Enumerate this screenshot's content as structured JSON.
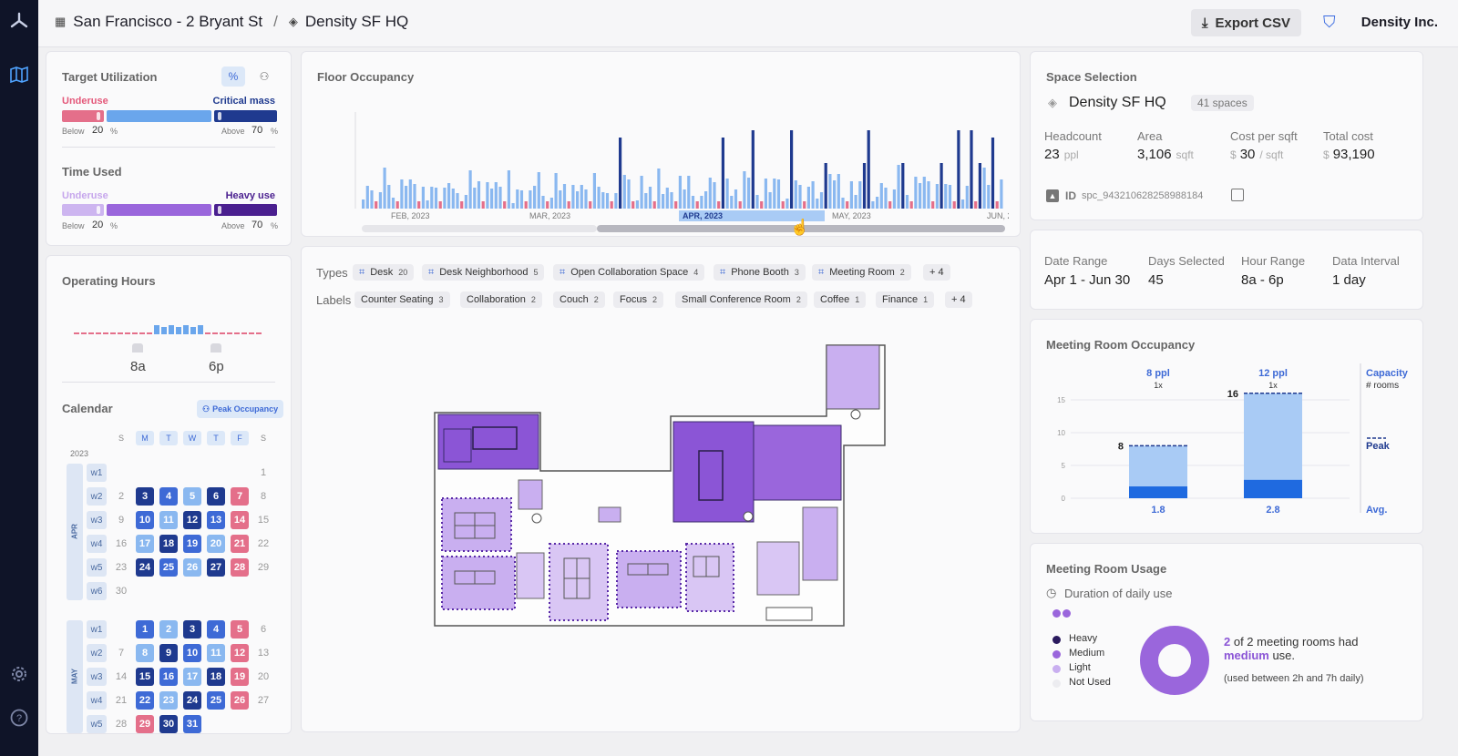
{
  "breadcrumb": {
    "site": "San Francisco - 2 Bryant St",
    "separator": "/",
    "space": "Density SF HQ"
  },
  "header": {
    "export_label": "Export CSV",
    "org_name": "Density Inc."
  },
  "target_utilization": {
    "title": "Target Utilization",
    "toggle_percent": "%",
    "underuse_label": "Underuse",
    "critical_label": "Critical mass",
    "below_label": "Below",
    "below_value": "20",
    "below_unit": "%",
    "above_label": "Above",
    "above_value": "70",
    "above_unit": "%"
  },
  "time_used": {
    "title": "Time Used",
    "underuse_label": "Underuse",
    "heavy_label": "Heavy use",
    "below_label": "Below",
    "below_value": "20",
    "below_unit": "%",
    "above_label": "Above",
    "above_value": "70",
    "above_unit": "%"
  },
  "operating_hours": {
    "title": "Operating Hours",
    "start": "8a",
    "end": "6p"
  },
  "calendar": {
    "title": "Calendar",
    "mode_label": "Peak Occupancy",
    "year": "2023",
    "day_headers": [
      "S",
      "M",
      "T",
      "W",
      "T",
      "F",
      "S"
    ],
    "months": [
      {
        "name": "APR",
        "weeks": [
          {
            "label": "w1",
            "days": [
              "",
              "",
              "",
              "",
              "",
              "",
              "1"
            ]
          },
          {
            "label": "w2",
            "days": [
              "2",
              "3",
              "4",
              "5",
              "6",
              "7",
              "8"
            ]
          },
          {
            "label": "w3",
            "days": [
              "9",
              "10",
              "11",
              "12",
              "13",
              "14",
              "15"
            ]
          },
          {
            "label": "w4",
            "days": [
              "16",
              "17",
              "18",
              "19",
              "20",
              "21",
              "22"
            ]
          },
          {
            "label": "w5",
            "days": [
              "23",
              "24",
              "25",
              "26",
              "27",
              "28",
              "29"
            ]
          },
          {
            "label": "w6",
            "days": [
              "30",
              "",
              "",
              "",
              "",
              "",
              ""
            ]
          }
        ]
      },
      {
        "name": "MAY",
        "weeks": [
          {
            "label": "w1",
            "days": [
              "",
              "1",
              "2",
              "3",
              "4",
              "5",
              "6"
            ]
          },
          {
            "label": "w2",
            "days": [
              "7",
              "8",
              "9",
              "10",
              "11",
              "12",
              "13"
            ]
          },
          {
            "label": "w3",
            "days": [
              "14",
              "15",
              "16",
              "17",
              "18",
              "19",
              "20"
            ]
          },
          {
            "label": "w4",
            "days": [
              "21",
              "22",
              "23",
              "24",
              "25",
              "26",
              "27"
            ]
          },
          {
            "label": "w5",
            "days": [
              "28",
              "29",
              "30",
              "31",
              "",
              "",
              ""
            ]
          }
        ]
      }
    ]
  },
  "floor_occupancy": {
    "title": "Floor Occupancy",
    "axis_months": [
      "FEB, 2023",
      "MAR, 2023",
      "APR, 2023",
      "MAY, 2023",
      "JUN, 2"
    ]
  },
  "filters": {
    "types_label": "Types",
    "types": [
      {
        "label": "Desk",
        "count": "20"
      },
      {
        "label": "Desk Neighborhood",
        "count": "5"
      },
      {
        "label": "Open Collaboration Space",
        "count": "4"
      },
      {
        "label": "Phone Booth",
        "count": "3"
      },
      {
        "label": "Meeting Room",
        "count": "2"
      }
    ],
    "types_more": "+ 4",
    "labels_label": "Labels",
    "labels": [
      {
        "label": "Counter Seating",
        "count": "3"
      },
      {
        "label": "Collaboration",
        "count": "2"
      },
      {
        "label": "Couch",
        "count": "2"
      },
      {
        "label": "Focus",
        "count": "2"
      },
      {
        "label": "Small Conference Room",
        "count": "2"
      },
      {
        "label": "Coffee",
        "count": "1"
      },
      {
        "label": "Finance",
        "count": "1"
      }
    ],
    "labels_more": "+ 4"
  },
  "space_selection": {
    "title": "Space Selection",
    "name": "Density SF HQ",
    "spaces_badge": "41 spaces",
    "stats": [
      {
        "label": "Headcount",
        "prefix": "",
        "value": "23",
        "unit": "ppl"
      },
      {
        "label": "Area",
        "prefix": "",
        "value": "3,106",
        "unit": "sqft"
      },
      {
        "label": "Cost per sqft",
        "prefix": "$",
        "value": "30",
        "unit": "/ sqft"
      },
      {
        "label": "Total cost",
        "prefix": "$",
        "value": "93,190",
        "unit": ""
      }
    ],
    "id_label": "ID",
    "id_value": "spc_943210628258988184"
  },
  "range": {
    "items": [
      {
        "label": "Date Range",
        "value": "Apr 1 - Jun 30"
      },
      {
        "label": "Days Selected",
        "value": "45"
      },
      {
        "label": "Hour Range",
        "value": "8a - 6p"
      },
      {
        "label": "Data Interval",
        "value": "1 day"
      }
    ]
  },
  "meeting_room_occupancy": {
    "title": "Meeting Room Occupancy",
    "legend_capacity": "Capacity",
    "legend_rooms": "# rooms",
    "legend_peak": "Peak",
    "legend_avg": "Avg."
  },
  "meeting_room_usage": {
    "title": "Meeting Room Usage",
    "subtitle": "Duration of daily use",
    "legend": [
      "Heavy",
      "Medium",
      "Light",
      "Not Used"
    ],
    "summary_count": "2",
    "summary_text": " of 2 meeting rooms had",
    "summary_level": "medium",
    "summary_tail": " use.",
    "summary_note": "(used between 2h and 7h daily)"
  },
  "colors": {
    "heavy": "#1f3a8f",
    "medium_blue": "#3e6ad6",
    "light_blue": "#8ab8f0",
    "underuse_pink": "#e46f8a",
    "purple": "#8b55d6",
    "light_purple": "#c9aff0"
  },
  "chart_data": [
    {
      "type": "bar",
      "title": "Meeting Room Occupancy",
      "categories": [
        "8 ppl",
        "12 ppl"
      ],
      "room_counts": [
        "1x",
        "1x"
      ],
      "series": [
        {
          "name": "Peak",
          "values": [
            8,
            16
          ]
        },
        {
          "name": "Avg.",
          "values": [
            1.8,
            2.8
          ]
        }
      ],
      "ylim": [
        0,
        15
      ],
      "yticks": [
        "0",
        "5",
        "10",
        "15"
      ]
    },
    {
      "type": "pie",
      "title": "Duration of daily use",
      "categories": [
        "Heavy",
        "Medium",
        "Light",
        "Not Used"
      ],
      "values": [
        0,
        2,
        0,
        0
      ]
    }
  ]
}
